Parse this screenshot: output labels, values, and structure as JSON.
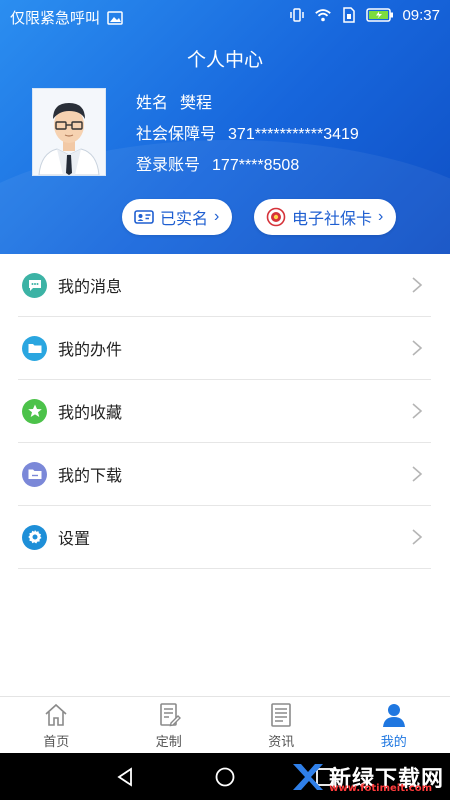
{
  "status_bar": {
    "carrier_text": "仅限紧急呼叫",
    "time": "09:37"
  },
  "header": {
    "title": "个人中心"
  },
  "profile": {
    "name_label": "姓名",
    "name_value": "樊程",
    "ssn_label": "社会保障号",
    "ssn_value": "371***********3419",
    "account_label": "登录账号",
    "account_value": "177****8508",
    "verified_label": "已实名",
    "card_label": "电子社保卡"
  },
  "menu": {
    "items": [
      {
        "label": "我的消息",
        "icon": "message-icon",
        "color": "#3cb3a5"
      },
      {
        "label": "我的办件",
        "icon": "folder-icon",
        "color": "#2aa6e0"
      },
      {
        "label": "我的收藏",
        "icon": "star-icon",
        "color": "#4cc24a"
      },
      {
        "label": "我的下载",
        "icon": "download-icon",
        "color": "#7b88d8"
      },
      {
        "label": "设置",
        "icon": "settings-gear-icon",
        "color": "#1e8fd8"
      }
    ]
  },
  "tabbar": {
    "tabs": [
      {
        "label": "首页",
        "icon": "home-icon",
        "active": false
      },
      {
        "label": "定制",
        "icon": "customize-icon",
        "active": false
      },
      {
        "label": "资讯",
        "icon": "news-icon",
        "active": false
      },
      {
        "label": "我的",
        "icon": "person-icon",
        "active": true
      }
    ]
  },
  "watermark": {
    "title": "新绿下载网",
    "url": "www.fotimeit.com"
  },
  "colors": {
    "header_blue": "#1766dc",
    "accent_blue": "#1f77e0",
    "pill_text": "#1f5fd1"
  }
}
